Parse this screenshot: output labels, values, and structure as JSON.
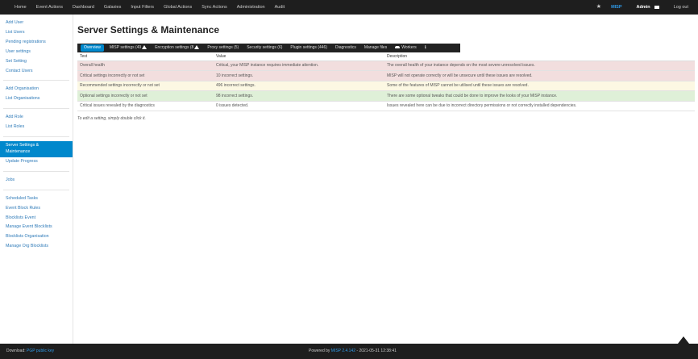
{
  "topnav": {
    "items": [
      "Home",
      "Event Actions",
      "Dashboard",
      "Galaxies",
      "Input Filters",
      "Global Actions",
      "Sync Actions",
      "Administration",
      "Audit"
    ],
    "brand": "MISP",
    "user": "Admin",
    "logout": "Log out"
  },
  "sidebar": {
    "group1": [
      "Add User",
      "List Users",
      "Pending registrations",
      "User settings",
      "Set Setting",
      "Contact Users"
    ],
    "group2": [
      "Add Organisation",
      "List Organisations"
    ],
    "group3": [
      "Add Role",
      "List Roles"
    ],
    "group4_active": "Server Settings & Maintenance",
    "group4_line1": "Server Settings &",
    "group4_line2": "Maintenance",
    "group4_after": "Update Progress",
    "group5": [
      "Jobs"
    ],
    "group6": [
      "Scheduled Tasks",
      "Event Block Rules",
      "Blocklists Event",
      "Manage Event Blocklists",
      "Blocklists Organisation",
      "Manage Org Blocklists"
    ]
  },
  "main": {
    "title": "Server Settings & Maintenance",
    "tabs": {
      "overview": "Overview",
      "misp": "MISP settings (49",
      "encryption": "Encryption settings (8",
      "proxy": "Proxy settings (5)",
      "security": "Security settings (6)",
      "plugin": "Plugin settings (446)",
      "diagnostics": "Diagnostics",
      "files": "Manage files",
      "workers": "Workers"
    },
    "columns": [
      "Test",
      "Value",
      "Description"
    ],
    "rows": [
      {
        "test": "Overall health",
        "value": "Critical, your MISP instance requires immediate attention.",
        "desc": "The overall health of your instance depends on the most severe unresolved issues."
      },
      {
        "test": "Critical settings incorrectly or not set",
        "value": "10 incorrect settings.",
        "desc": "MISP will not operate correctly or will be unsecure until these issues are resolved."
      },
      {
        "test": "Recommended settings incorrectly or not set",
        "value": "496 incorrect settings.",
        "desc": "Some of the features of MISP cannot be utilised until these issues are resolved."
      },
      {
        "test": "Optional settings incorrectly or not set",
        "value": "98 incorrect settings.",
        "desc": "There are some optional tweaks that could be done to improve the looks of your MISP instance."
      },
      {
        "test": "Critical issues revealed by the diagnostics",
        "value": "0 issues detected.",
        "desc": "Issues revealed here can be due to incorrect directory permissions or not correctly installed dependencies."
      }
    ],
    "note": "To edit a setting, simply double click it."
  },
  "footer": {
    "download_label": "Download:",
    "pgp": "PGP public key",
    "powered": "Powered by",
    "version": "MISP 2.4.142",
    "date": "- 2021-05-31 12:38:41"
  },
  "colors": {
    "red": "#f2dede",
    "yellow": "#fcf8e3",
    "green": "#dff0d8",
    "accent": "#0088cc"
  }
}
